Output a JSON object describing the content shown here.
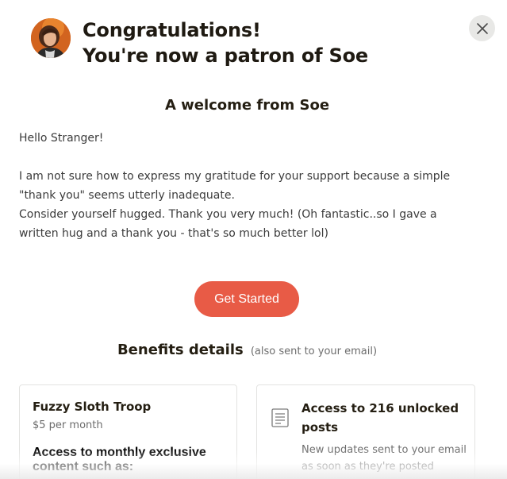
{
  "creator": {
    "name": "Soe",
    "avatar_icon": "creator-avatar"
  },
  "header": {
    "line1": "Congratulations!",
    "line2": "You're now a patron of Soe",
    "close_icon": "close-icon"
  },
  "welcome": {
    "title": "A welcome from Soe",
    "greeting": "Hello Stranger!",
    "paragraph1": "I am not sure how to express my gratitude for your support because a simple \"thank you\" seems utterly inadequate.",
    "paragraph2": "Consider yourself hugged. Thank you very much! (Oh fantastic..so I gave a written hug and a thank you - that's so much better lol)"
  },
  "cta": {
    "label": "Get Started",
    "color": "#e85b46"
  },
  "benefits": {
    "title": "Benefits details",
    "note": "(also sent to your email)",
    "tier": {
      "name": "Fuzzy Sloth Troop",
      "price": "$5 per month",
      "description": "Access to monthly exclusive content such as:"
    },
    "unlocked": {
      "icon": "document-icon",
      "title": "Access to 216 unlocked posts",
      "note": "New updates sent to your email as soon as they're posted"
    }
  }
}
